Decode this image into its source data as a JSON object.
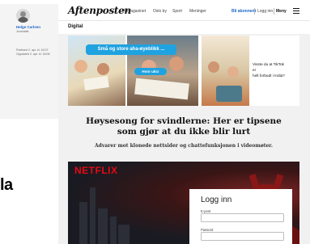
{
  "author": {
    "name": "Helge Carlsen",
    "role": "Journalist",
    "published": "Publisert 2. apr. kl. 16:07",
    "updated": "Oppdatert 2. apr. kl. 18:06"
  },
  "left_fragment_text": "la",
  "header": {
    "logo": "Aftenposten",
    "nav": [
      "A-magasinet",
      "Oslo by",
      "Sport",
      "Meninger"
    ],
    "subscribe_label": "Bli abonnent",
    "login_label": "Logg inn",
    "menu_label": "Meny"
  },
  "section": {
    "title": "Digital"
  },
  "ad": {
    "bubble_text": "Små og store aha-øyeblikk ...",
    "pill_text": "Hvor ukc!",
    "question_lines": [
      "Visste du at TikTok",
      "er",
      "helt forbudt i India?"
    ]
  },
  "article": {
    "headline_lines": [
      "Høysesong for svindlerne: Her er tipsene",
      "som gjør at du ikke blir lurt"
    ],
    "lead": "Advarer mot klonede nettsider og chattefunksjonen i videomøter."
  },
  "hero": {
    "brand": "NETFLIX",
    "login": {
      "title": "Logg inn",
      "email_label": "E-post",
      "email_value": "",
      "password_label": "Passord",
      "password_value": ""
    }
  },
  "colors": {
    "accent": "#1a66c9",
    "netflix_red": "#e50914",
    "ad_blue": "#1fa2e0"
  }
}
